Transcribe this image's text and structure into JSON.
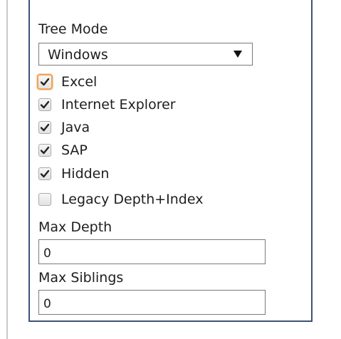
{
  "tree_mode": {
    "label": "Tree Mode",
    "selected": "Windows"
  },
  "checkboxes": [
    {
      "label": "Excel",
      "checked": true,
      "focused": true
    },
    {
      "label": "Internet Explorer",
      "checked": true,
      "focused": false
    },
    {
      "label": "Java",
      "checked": true,
      "focused": false
    },
    {
      "label": "SAP",
      "checked": true,
      "focused": false
    },
    {
      "label": "Hidden",
      "checked": true,
      "focused": false
    },
    {
      "label": "Legacy Depth+Index",
      "checked": false,
      "focused": false
    }
  ],
  "max_depth": {
    "label": "Max Depth",
    "value": "0"
  },
  "max_siblings": {
    "label": "Max Siblings",
    "value": "0"
  },
  "colors": {
    "panel_border": "#3d5278",
    "focus_ring": "#f0a35a"
  },
  "icons": {
    "check": "check-icon",
    "dropdown": "chevron-down-icon"
  }
}
